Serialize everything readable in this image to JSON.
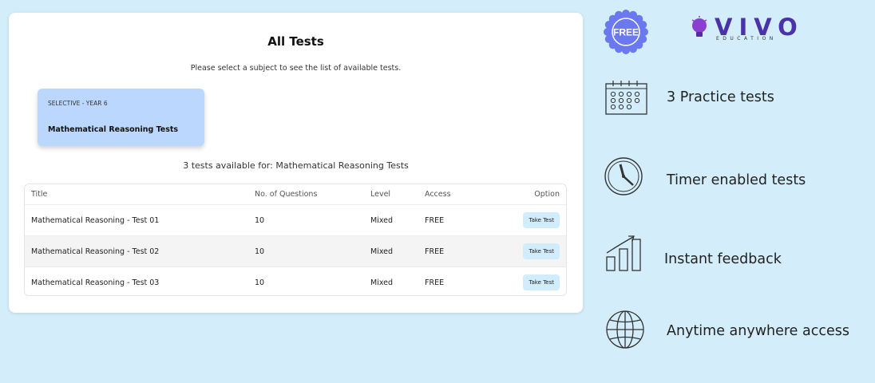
{
  "main": {
    "title": "All Tests",
    "subtitle": "Please select a subject to see the list of available tests.",
    "subject": {
      "category": "SELECTIVE - YEAR 6",
      "name": "Mathematical Reasoning Tests"
    },
    "count_text": "3 tests available for: Mathematical Reasoning Tests",
    "table": {
      "headers": {
        "title": "Title",
        "questions": "No. of Questions",
        "level": "Level",
        "access": "Access",
        "option": "Option"
      },
      "rows": [
        {
          "title": "Mathematical Reasoning - Test 01",
          "questions": "10",
          "level": "Mixed",
          "access": "FREE",
          "button": "Take Test"
        },
        {
          "title": "Mathematical Reasoning - Test 02",
          "questions": "10",
          "level": "Mixed",
          "access": "FREE",
          "button": "Take Test"
        },
        {
          "title": "Mathematical Reasoning - Test 03",
          "questions": "10",
          "level": "Mixed",
          "access": "FREE",
          "button": "Take Test"
        }
      ]
    }
  },
  "promo": {
    "badge_text": "FREE",
    "logo_text": "VIVO",
    "logo_sub": "EDUCATION",
    "features": [
      {
        "icon": "calendar-icon",
        "text": "3 Practice tests"
      },
      {
        "icon": "clock-icon",
        "text": "Timer enabled tests"
      },
      {
        "icon": "bar-chart-icon",
        "text": "Instant feedback"
      },
      {
        "icon": "globe-icon",
        "text": "Anytime anywhere access"
      }
    ]
  },
  "colors": {
    "background": "#d3eefa",
    "subject_card": "#bcd7fd",
    "button": "#d1ecfb",
    "badge": "#6a79f0",
    "logo": "#4a33a8"
  }
}
